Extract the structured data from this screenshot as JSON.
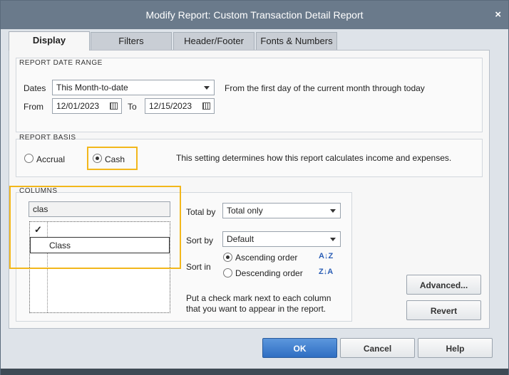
{
  "window": {
    "title": "Modify Report: Custom Transaction Detail Report",
    "close": "×"
  },
  "tabs": [
    {
      "label": "Display"
    },
    {
      "label": "Filters"
    },
    {
      "label": "Header/Footer"
    },
    {
      "label": "Fonts & Numbers"
    }
  ],
  "date_range": {
    "heading": "REPORT DATE RANGE",
    "dates_label": "Dates",
    "dates_value": "This Month-to-date",
    "description": "From the first day of the current month through today",
    "from_label": "From",
    "from_value": "12/01/2023",
    "to_label": "To",
    "to_value": "12/15/2023"
  },
  "basis": {
    "heading": "REPORT BASIS",
    "accrual_label": "Accrual",
    "cash_label": "Cash",
    "selected": "cash",
    "description": "This setting determines how this report calculates income and expenses."
  },
  "columns": {
    "heading": "COLUMNS",
    "search_value": "clas",
    "check_mark": "✓",
    "items": [
      {
        "label": "Class"
      }
    ],
    "total_by_label": "Total by",
    "total_by_value": "Total only",
    "sort_by_label": "Sort by",
    "sort_by_value": "Default",
    "sort_in_label": "Sort in",
    "ascending_label": "Ascending order",
    "descending_label": "Descending order",
    "asc_icon": "A↓Z",
    "desc_icon": "Z↓A",
    "hint": "Put a check mark next to each column that you want to appear in the report."
  },
  "buttons": {
    "advanced": "Advanced...",
    "revert": "Revert",
    "ok": "OK",
    "cancel": "Cancel",
    "help": "Help"
  }
}
